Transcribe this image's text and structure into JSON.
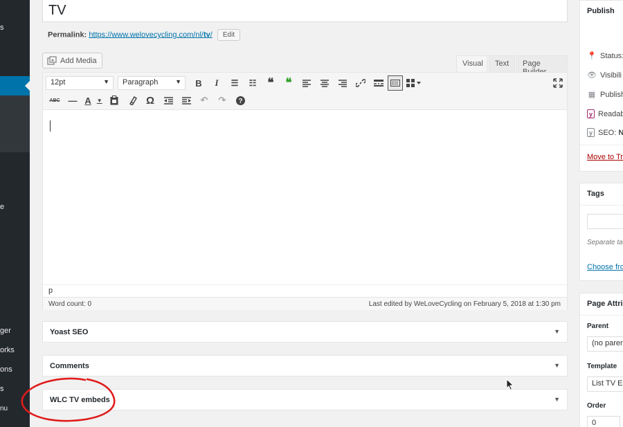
{
  "admin_menu": {
    "fragments": [
      "s",
      "e",
      "ger",
      "orks",
      "ons",
      "s",
      "nu"
    ]
  },
  "title": {
    "value": "TV"
  },
  "permalink": {
    "label": "Permalink:",
    "url_prefix": "https://www.welovecycling.com/nl/",
    "slug": "tv",
    "url_suffix": "/",
    "edit_label": "Edit"
  },
  "add_media": {
    "label": "Add Media"
  },
  "editor_tabs": [
    {
      "label": "Visual",
      "active": true
    },
    {
      "label": "Text",
      "active": false
    },
    {
      "label": "Page Builder",
      "active": false
    }
  ],
  "toolbar": {
    "font_size": "12pt",
    "format": "Paragraph",
    "row1_icons": [
      "bold-icon",
      "italic-icon",
      "bullet-list-icon",
      "numbered-list-icon",
      "blockquote-icon",
      "green-quote-icon",
      "align-left-icon",
      "align-center-icon",
      "align-right-icon",
      "link-icon",
      "read-more-icon",
      "toolbar-toggle-icon",
      "grid-icon",
      "fullscreen-icon"
    ],
    "row2_icons": [
      "strikethrough-icon",
      "horizontal-rule-icon",
      "text-color-icon",
      "paste-text-icon",
      "clear-format-icon",
      "special-char-icon",
      "outdent-icon",
      "indent-icon",
      "undo-icon",
      "redo-icon",
      "help-icon"
    ]
  },
  "editor": {
    "path": "p",
    "word_count": "Word count: 0",
    "last_edited": "Last edited by WeLoveCycling on February 5, 2018 at 1:30 pm"
  },
  "metaboxes": [
    {
      "title": "Yoast SEO"
    },
    {
      "title": "Comments"
    },
    {
      "title": "WLC TV embeds"
    }
  ],
  "publish_box": {
    "title": "Publish",
    "rows": [
      {
        "icon": "pin-icon",
        "text": "Status:"
      },
      {
        "icon": "eye-icon",
        "text": "Visibili"
      },
      {
        "icon": "calendar-icon",
        "text": "Publish"
      },
      {
        "icon": "yoast-icon",
        "text": "Readab"
      },
      {
        "icon": "yoast-icon",
        "text": "SEO: ",
        "bold_text": "No"
      }
    ],
    "trash_label": "Move to Tra"
  },
  "tags_box": {
    "title": "Tags",
    "hint": "Separate ta",
    "choose_label": "Choose fro"
  },
  "page_attributes": {
    "title": "Page Attri",
    "parent_label": "Parent",
    "parent_value": "(no paren",
    "template_label": "Template",
    "template_value": "List TV E",
    "order_label": "Order",
    "order_value": "0"
  },
  "colors": {
    "admin_bar": "#23282d",
    "accent": "#0073aa",
    "annotation": "#e01b1b"
  }
}
